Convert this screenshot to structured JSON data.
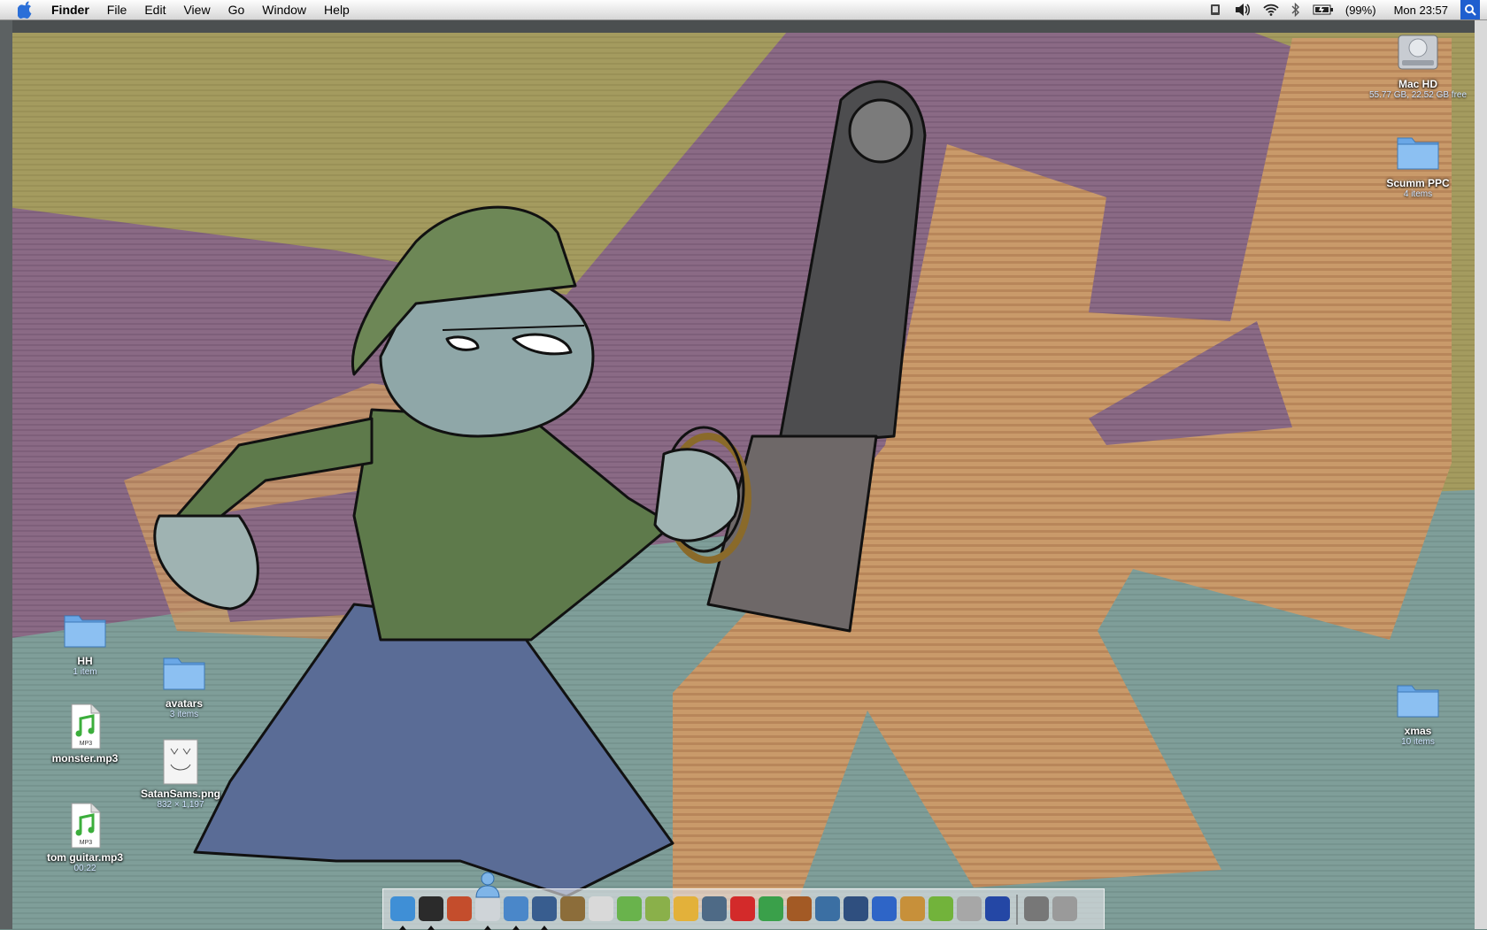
{
  "menubar": {
    "app_name": "Finder",
    "menus": [
      "File",
      "Edit",
      "View",
      "Go",
      "Window",
      "Help"
    ],
    "battery": "(99%)",
    "clock": "Mon 23:57",
    "icons": [
      "apple-icon",
      "sync-icon",
      "volume-icon",
      "wifi-icon",
      "bluetooth-icon",
      "battery-icon",
      "spotlight-icon"
    ]
  },
  "desktop": {
    "right_icons": [
      {
        "name": "Mac HD",
        "info": "55.77 GB, 22.52 GB free",
        "icon": "hard-drive-icon"
      },
      {
        "name": "Scumm PPC",
        "info": "4 items",
        "icon": "folder-icon"
      },
      {
        "name": "xmas",
        "info": "10 items",
        "icon": "folder-icon"
      }
    ],
    "left_icons": [
      {
        "name": "HH",
        "info": "1 item",
        "icon": "folder-icon"
      },
      {
        "name": "avatars",
        "info": "3 items",
        "icon": "folder-icon"
      },
      {
        "name": "monster.mp3",
        "info": "",
        "icon": "mp3-file-icon",
        "badge": "MP3"
      },
      {
        "name": "SatanSams.png",
        "info": "832 × 1,197",
        "icon": "image-file-icon"
      },
      {
        "name": "tom guitar.mp3",
        "info": "00:22",
        "icon": "mp3-file-icon",
        "badge": "MP3"
      }
    ]
  },
  "dock": {
    "apps": [
      {
        "name": "finder",
        "color": "#3f8fd6",
        "running": true
      },
      {
        "name": "dashboard",
        "color": "#2b2b2b",
        "running": true
      },
      {
        "name": "mail-stamp",
        "color": "#c44d2c",
        "running": false
      },
      {
        "name": "blank",
        "color": "#cfd4d8",
        "running": true
      },
      {
        "name": "safari",
        "color": "#4a87c9",
        "running": true
      },
      {
        "name": "address-book",
        "color": "#385d8f",
        "running": true
      },
      {
        "name": "archive",
        "color": "#8c6d3a",
        "running": false
      },
      {
        "name": "preview",
        "color": "#d9d9d9",
        "running": false
      },
      {
        "name": "itunes",
        "color": "#69b34c",
        "running": false
      },
      {
        "name": "textedit",
        "color": "#8ab04a",
        "running": false
      },
      {
        "name": "script",
        "color": "#e3b13a",
        "running": false
      },
      {
        "name": "pen",
        "color": "#4e6a86",
        "running": false
      },
      {
        "name": "flash",
        "color": "#d32a2a",
        "running": false
      },
      {
        "name": "dreamweaver",
        "color": "#3aa04a",
        "running": false
      },
      {
        "name": "guitar",
        "color": "#a35a25",
        "running": false
      },
      {
        "name": "iphoto",
        "color": "#3b6fa3",
        "running": false
      },
      {
        "name": "imovie",
        "color": "#2f4f7f",
        "running": false
      },
      {
        "name": "word",
        "color": "#2e65c7",
        "running": false
      },
      {
        "name": "photo",
        "color": "#c7903a",
        "running": false
      },
      {
        "name": "graphics",
        "color": "#72b33b",
        "running": false
      },
      {
        "name": "apple-app",
        "color": "#a7a7a7",
        "running": false
      },
      {
        "name": "bird",
        "color": "#2447a5",
        "running": false
      }
    ],
    "extras": [
      {
        "name": "system-monitor",
        "color": "#777"
      },
      {
        "name": "trash",
        "color": "#9a9a9a"
      }
    ]
  }
}
